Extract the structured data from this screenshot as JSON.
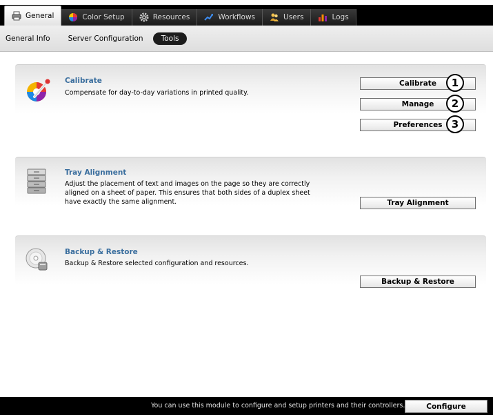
{
  "tabs": [
    {
      "label": "General",
      "icon": "printer-icon",
      "active": true
    },
    {
      "label": "Color Setup",
      "icon": "color-wheel-icon"
    },
    {
      "label": "Resources",
      "icon": "gear-icon"
    },
    {
      "label": "Workflows",
      "icon": "workflow-arrows-icon"
    },
    {
      "label": "Users",
      "icon": "users-icon"
    },
    {
      "label": "Logs",
      "icon": "bar-chart-icon"
    }
  ],
  "subnav": {
    "items": [
      "General Info",
      "Server Configuration",
      "Tools"
    ],
    "active": "Tools"
  },
  "panels": {
    "calibrate": {
      "title": "Calibrate",
      "description": "Compensate for day-to-day variations in printed quality.",
      "buttons": [
        "Calibrate",
        "Manage",
        "Preferences"
      ],
      "badges": [
        "1",
        "2",
        "3"
      ]
    },
    "tray": {
      "title": "Tray Alignment",
      "description": "Adjust the placement of text and images on the page so they are correctly aligned on a sheet of paper. This ensures that both sides of a duplex sheet have exactly the same alignment.",
      "button": "Tray Alignment"
    },
    "backup": {
      "title": "Backup & Restore",
      "description": "Backup & Restore selected configuration and resources.",
      "button": "Backup & Restore"
    }
  },
  "footer": {
    "text": "You can use this module to configure and setup printers and their controllers.",
    "button": "Configure"
  },
  "colors": {
    "title_blue": "#3a6e9e",
    "bar_black": "#000000"
  }
}
